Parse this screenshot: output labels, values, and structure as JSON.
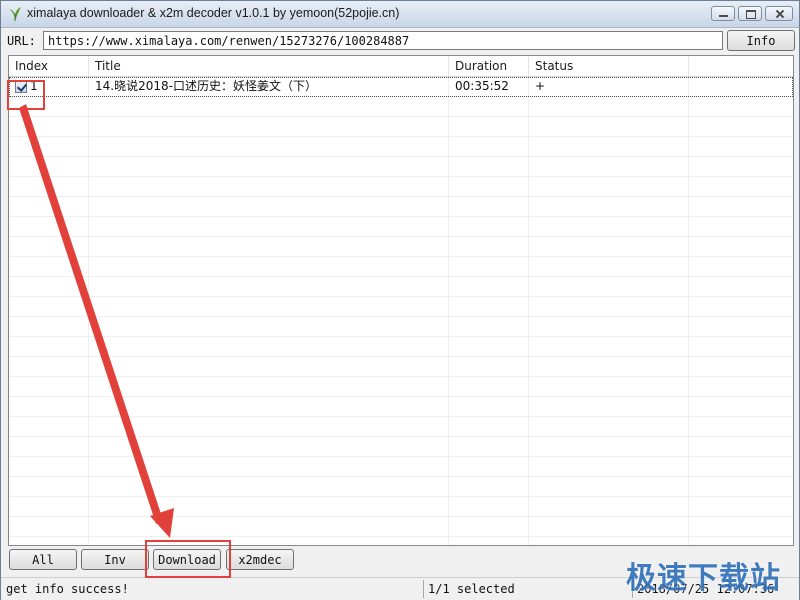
{
  "window": {
    "title": "ximalaya downloader & x2m decoder v1.0.1 by yemoon(52pojie.cn)"
  },
  "url_bar": {
    "label": "URL:",
    "value": "https://www.ximalaya.com/renwen/15273276/100284887",
    "info_button": "Info"
  },
  "list": {
    "columns": [
      "Index",
      "Title",
      "Duration",
      "Status"
    ],
    "rows": [
      {
        "checked": true,
        "index": "1",
        "title": "14.晓说2018-口述历史：妖怪姜文（下）",
        "duration": "00:35:52",
        "status": "+"
      }
    ]
  },
  "buttons": {
    "all": "All",
    "inv": "Inv",
    "download": "Download",
    "x2mdec": "x2mdec"
  },
  "status_bar": {
    "message": "get info success!",
    "selection": "1/1 selected",
    "timestamp": "2018/07/25 12:07:36"
  },
  "watermark": "极速下载站",
  "colors": {
    "highlight": "#e2403a",
    "watermark": "#2d6fb8"
  }
}
